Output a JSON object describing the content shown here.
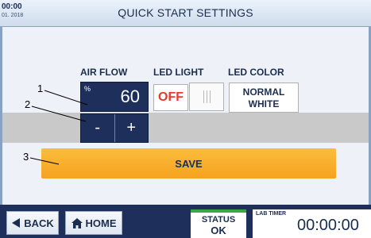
{
  "header": {
    "time": "00:00",
    "date": "01. 2018",
    "title": "QUICK START SETTINGS"
  },
  "air_flow": {
    "label": "AIR FLOW",
    "unit": "%",
    "value": "60",
    "decrement_label": "-",
    "increment_label": "+"
  },
  "led_light": {
    "label": "LED LIGHT",
    "state_label": "OFF"
  },
  "led_color": {
    "label": "LED COLOR",
    "line1": "NORMAL",
    "line2": "WHITE"
  },
  "save": {
    "label": "SAVE"
  },
  "callouts": [
    "1",
    "2",
    "3"
  ],
  "footer": {
    "back_label": "BACK",
    "home_label": "HOME",
    "status_title": "STATUS",
    "status_value": "OK",
    "timer_label": "LAB TIMER",
    "timer_value": "00:00:00"
  },
  "colors": {
    "panel_navy": "#1d2f5a",
    "save_orange": "#f5a21f",
    "off_red": "#e43b2c",
    "status_green": "#3aa845"
  }
}
